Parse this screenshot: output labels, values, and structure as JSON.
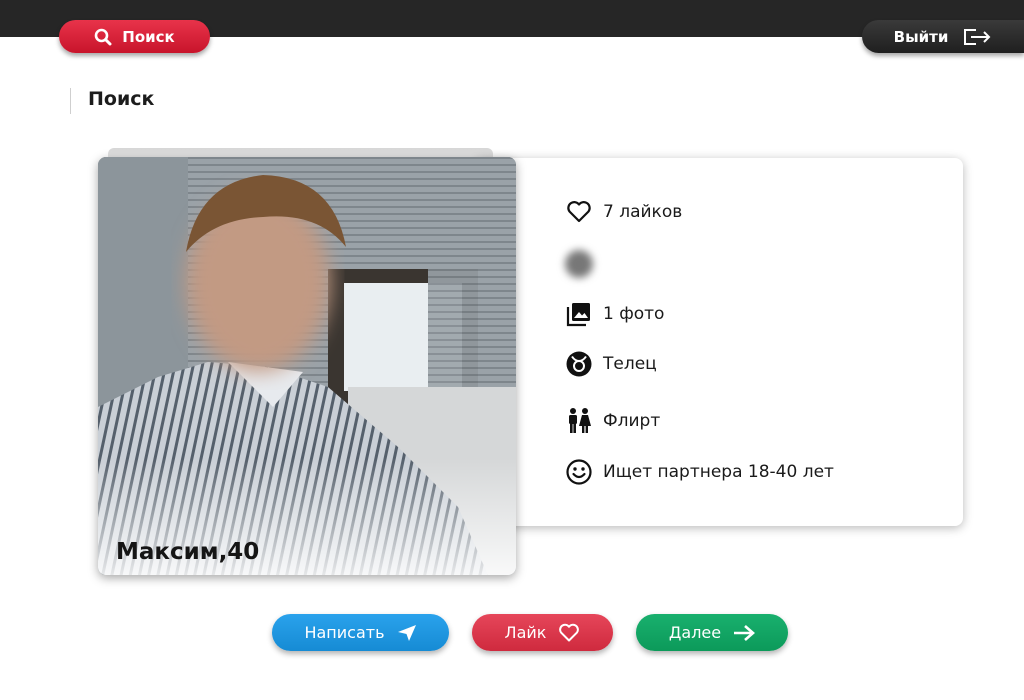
{
  "header": {
    "search_label": "Поиск",
    "logout_label": "Выйти"
  },
  "page": {
    "title": "Поиск"
  },
  "profile": {
    "name_age": "Максим,40",
    "likes": "7 лайков",
    "photos": "1 фото",
    "zodiac": "Телец",
    "goal": "Флирт",
    "looking_for": "Ищет партнера 18-40 лет"
  },
  "actions": {
    "write_label": "Написать",
    "like_label": "Лайк",
    "next_label": "Далее"
  },
  "colors": {
    "topbar": "#262626",
    "search_red": "#d81f36",
    "write_blue": "#1e96e0",
    "like_red": "#d93549",
    "next_green": "#12a664"
  },
  "icons": {
    "search": "search-icon",
    "logout": "logout-icon",
    "likes": "heart-icon",
    "photos": "photo-gallery-icon",
    "zodiac": "taurus-icon",
    "goal": "couple-icon",
    "looking_for": "smiley-icon",
    "write": "send-icon",
    "like": "heart-icon",
    "next": "arrow-right-icon"
  }
}
